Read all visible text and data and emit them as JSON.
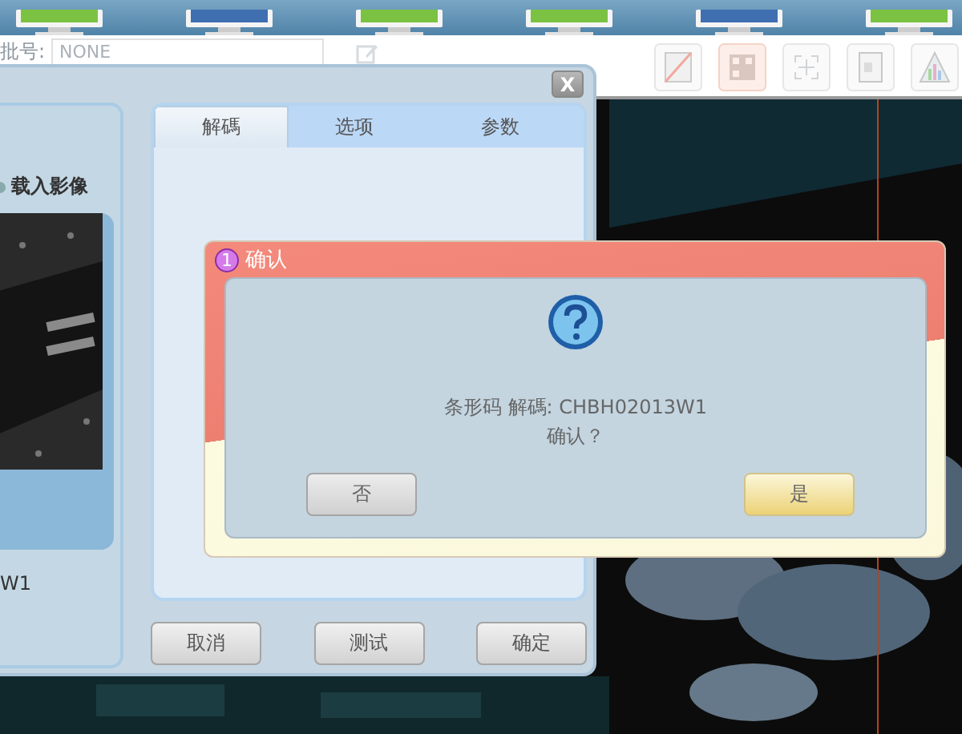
{
  "toolbar": {
    "batch_label": "批号:",
    "batch_value": "NONE"
  },
  "settings_dialog": {
    "close": "X",
    "load_label": "载入影像",
    "barcode_fragment": "W1",
    "tabs": [
      {
        "label": "解碼",
        "selected": true
      },
      {
        "label": "选项",
        "selected": false
      },
      {
        "label": "参数",
        "selected": false
      }
    ],
    "buttons": [
      "取消",
      "测试",
      "确定"
    ]
  },
  "confirm_dialog": {
    "badge": "1",
    "title": "确认",
    "message_lines": [
      "条形码 解碼: CHBH02013W1",
      "确认？"
    ],
    "buttons": [
      {
        "label": "否",
        "kind": "default"
      },
      {
        "label": "是",
        "kind": "primary"
      }
    ]
  }
}
